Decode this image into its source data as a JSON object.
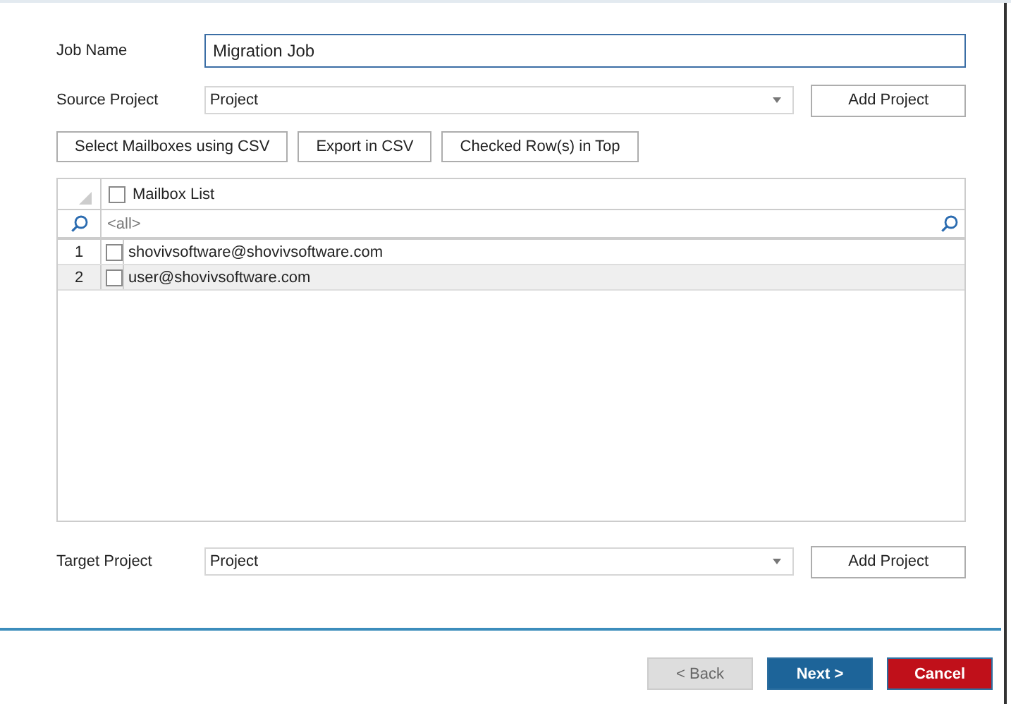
{
  "job_name": {
    "label": "Job Name",
    "value": "Migration Job"
  },
  "source_project": {
    "label": "Source Project",
    "value": "Project",
    "button": "Add Project"
  },
  "toolbar": [
    "Select Mailboxes using CSV",
    "Export in CSV",
    "Checked Row(s) in Top"
  ],
  "grid": {
    "header": {
      "label": "Mailbox List",
      "checked": false
    },
    "filter": "<all>",
    "rows": [
      {
        "number": "1",
        "mailbox": "shovivsoftware@shovivsoftware.com",
        "checked": false,
        "selected": false
      },
      {
        "number": "2",
        "mailbox": "user@shovivsoftware.com",
        "checked": false,
        "selected": true
      }
    ]
  },
  "target_project": {
    "label": "Target Project",
    "value": "Project",
    "button": "Add Project"
  },
  "footer": [
    {
      "label": "< Back",
      "kind": "back",
      "disabled": true
    },
    {
      "label": "Next >",
      "kind": "next",
      "disabled": false
    },
    {
      "label": "Cancel",
      "kind": "cancel",
      "disabled": false
    }
  ]
}
